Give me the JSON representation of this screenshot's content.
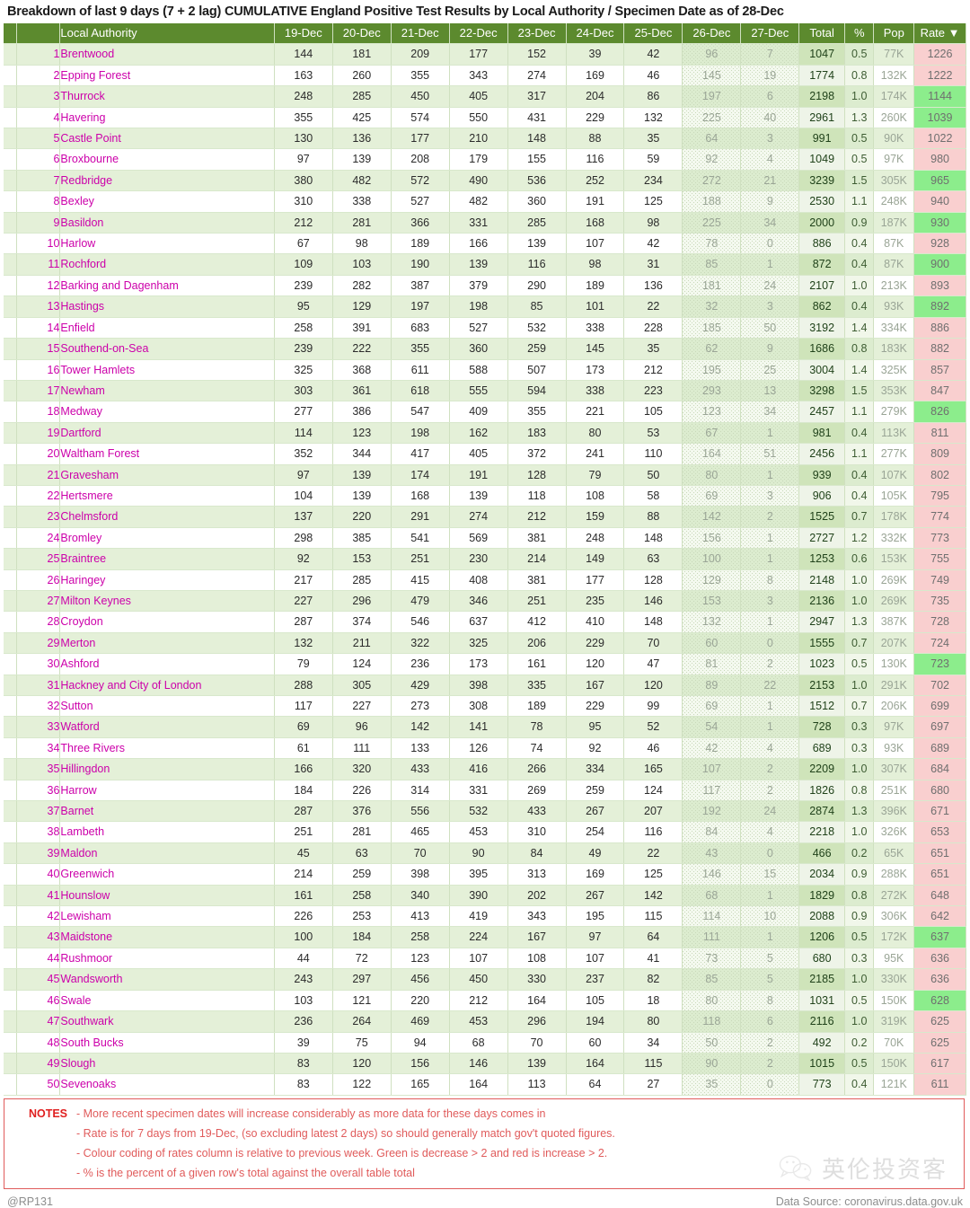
{
  "title": "Breakdown of last 9 days (7 + 2 lag)  CUMULATIVE England Positive Test Results by Local Authority / Specimen Date as of 28-Dec",
  "colors": {
    "header_green": "#5C8A2E",
    "row_stripe": "#e4f0d8",
    "rate_increase": "#f9cfcf",
    "rate_decrease": "#8ced8c",
    "authority_text": "#CC00AA",
    "notes_border": "#e05b5b"
  },
  "table": {
    "columns": [
      "Local Authority",
      "19-Dec",
      "20-Dec",
      "21-Dec",
      "22-Dec",
      "23-Dec",
      "24-Dec",
      "25-Dec",
      "26-Dec",
      "27-Dec",
      "Total",
      "%",
      "Pop",
      "Rate"
    ],
    "sort_column": "Rate",
    "sort_arrow": "▼",
    "lag_columns": [
      "26-Dec",
      "27-Dec"
    ],
    "rows": [
      {
        "n": "1",
        "la": "Brentwood",
        "d": [
          "144",
          "181",
          "209",
          "177",
          "152",
          "39",
          "42",
          "96",
          "7"
        ],
        "total": "1047",
        "pct": "0.5",
        "pop": "77K",
        "rate": "1226",
        "trend": "up"
      },
      {
        "n": "2",
        "la": "Epping Forest",
        "d": [
          "163",
          "260",
          "355",
          "343",
          "274",
          "169",
          "46",
          "145",
          "19"
        ],
        "total": "1774",
        "pct": "0.8",
        "pop": "132K",
        "rate": "1222",
        "trend": "up"
      },
      {
        "n": "3",
        "la": "Thurrock",
        "d": [
          "248",
          "285",
          "450",
          "405",
          "317",
          "204",
          "86",
          "197",
          "6"
        ],
        "total": "2198",
        "pct": "1.0",
        "pop": "174K",
        "rate": "1144",
        "trend": "down"
      },
      {
        "n": "4",
        "la": "Havering",
        "d": [
          "355",
          "425",
          "574",
          "550",
          "431",
          "229",
          "132",
          "225",
          "40"
        ],
        "total": "2961",
        "pct": "1.3",
        "pop": "260K",
        "rate": "1039",
        "trend": "down"
      },
      {
        "n": "5",
        "la": "Castle Point",
        "d": [
          "130",
          "136",
          "177",
          "210",
          "148",
          "88",
          "35",
          "64",
          "3"
        ],
        "total": "991",
        "pct": "0.5",
        "pop": "90K",
        "rate": "1022",
        "trend": "up"
      },
      {
        "n": "6",
        "la": "Broxbourne",
        "d": [
          "97",
          "139",
          "208",
          "179",
          "155",
          "116",
          "59",
          "92",
          "4"
        ],
        "total": "1049",
        "pct": "0.5",
        "pop": "97K",
        "rate": "980",
        "trend": "up"
      },
      {
        "n": "7",
        "la": "Redbridge",
        "d": [
          "380",
          "482",
          "572",
          "490",
          "536",
          "252",
          "234",
          "272",
          "21"
        ],
        "total": "3239",
        "pct": "1.5",
        "pop": "305K",
        "rate": "965",
        "trend": "down"
      },
      {
        "n": "8",
        "la": "Bexley",
        "d": [
          "310",
          "338",
          "527",
          "482",
          "360",
          "191",
          "125",
          "188",
          "9"
        ],
        "total": "2530",
        "pct": "1.1",
        "pop": "248K",
        "rate": "940",
        "trend": "up"
      },
      {
        "n": "9",
        "la": "Basildon",
        "d": [
          "212",
          "281",
          "366",
          "331",
          "285",
          "168",
          "98",
          "225",
          "34"
        ],
        "total": "2000",
        "pct": "0.9",
        "pop": "187K",
        "rate": "930",
        "trend": "down"
      },
      {
        "n": "10",
        "la": "Harlow",
        "d": [
          "67",
          "98",
          "189",
          "166",
          "139",
          "107",
          "42",
          "78",
          "0"
        ],
        "total": "886",
        "pct": "0.4",
        "pop": "87K",
        "rate": "928",
        "trend": "up"
      },
      {
        "n": "11",
        "la": "Rochford",
        "d": [
          "109",
          "103",
          "190",
          "139",
          "116",
          "98",
          "31",
          "85",
          "1"
        ],
        "total": "872",
        "pct": "0.4",
        "pop": "87K",
        "rate": "900",
        "trend": "down"
      },
      {
        "n": "12",
        "la": "Barking and Dagenham",
        "d": [
          "239",
          "282",
          "387",
          "379",
          "290",
          "189",
          "136",
          "181",
          "24"
        ],
        "total": "2107",
        "pct": "1.0",
        "pop": "213K",
        "rate": "893",
        "trend": "up"
      },
      {
        "n": "13",
        "la": "Hastings",
        "d": [
          "95",
          "129",
          "197",
          "198",
          "85",
          "101",
          "22",
          "32",
          "3"
        ],
        "total": "862",
        "pct": "0.4",
        "pop": "93K",
        "rate": "892",
        "trend": "down"
      },
      {
        "n": "14",
        "la": "Enfield",
        "d": [
          "258",
          "391",
          "683",
          "527",
          "532",
          "338",
          "228",
          "185",
          "50"
        ],
        "total": "3192",
        "pct": "1.4",
        "pop": "334K",
        "rate": "886",
        "trend": "up"
      },
      {
        "n": "15",
        "la": "Southend-on-Sea",
        "d": [
          "239",
          "222",
          "355",
          "360",
          "259",
          "145",
          "35",
          "62",
          "9"
        ],
        "total": "1686",
        "pct": "0.8",
        "pop": "183K",
        "rate": "882",
        "trend": "up"
      },
      {
        "n": "16",
        "la": "Tower Hamlets",
        "d": [
          "325",
          "368",
          "611",
          "588",
          "507",
          "173",
          "212",
          "195",
          "25"
        ],
        "total": "3004",
        "pct": "1.4",
        "pop": "325K",
        "rate": "857",
        "trend": "up"
      },
      {
        "n": "17",
        "la": "Newham",
        "d": [
          "303",
          "361",
          "618",
          "555",
          "594",
          "338",
          "223",
          "293",
          "13"
        ],
        "total": "3298",
        "pct": "1.5",
        "pop": "353K",
        "rate": "847",
        "trend": "up"
      },
      {
        "n": "18",
        "la": "Medway",
        "d": [
          "277",
          "386",
          "547",
          "409",
          "355",
          "221",
          "105",
          "123",
          "34"
        ],
        "total": "2457",
        "pct": "1.1",
        "pop": "279K",
        "rate": "826",
        "trend": "down"
      },
      {
        "n": "19",
        "la": "Dartford",
        "d": [
          "114",
          "123",
          "198",
          "162",
          "183",
          "80",
          "53",
          "67",
          "1"
        ],
        "total": "981",
        "pct": "0.4",
        "pop": "113K",
        "rate": "811",
        "trend": "up"
      },
      {
        "n": "20",
        "la": "Waltham Forest",
        "d": [
          "352",
          "344",
          "417",
          "405",
          "372",
          "241",
          "110",
          "164",
          "51"
        ],
        "total": "2456",
        "pct": "1.1",
        "pop": "277K",
        "rate": "809",
        "trend": "up"
      },
      {
        "n": "21",
        "la": "Gravesham",
        "d": [
          "97",
          "139",
          "174",
          "191",
          "128",
          "79",
          "50",
          "80",
          "1"
        ],
        "total": "939",
        "pct": "0.4",
        "pop": "107K",
        "rate": "802",
        "trend": "up"
      },
      {
        "n": "22",
        "la": "Hertsmere",
        "d": [
          "104",
          "139",
          "168",
          "139",
          "118",
          "108",
          "58",
          "69",
          "3"
        ],
        "total": "906",
        "pct": "0.4",
        "pop": "105K",
        "rate": "795",
        "trend": "up"
      },
      {
        "n": "23",
        "la": "Chelmsford",
        "d": [
          "137",
          "220",
          "291",
          "274",
          "212",
          "159",
          "88",
          "142",
          "2"
        ],
        "total": "1525",
        "pct": "0.7",
        "pop": "178K",
        "rate": "774",
        "trend": "up"
      },
      {
        "n": "24",
        "la": "Bromley",
        "d": [
          "298",
          "385",
          "541",
          "569",
          "381",
          "248",
          "148",
          "156",
          "1"
        ],
        "total": "2727",
        "pct": "1.2",
        "pop": "332K",
        "rate": "773",
        "trend": "up"
      },
      {
        "n": "25",
        "la": "Braintree",
        "d": [
          "92",
          "153",
          "251",
          "230",
          "214",
          "149",
          "63",
          "100",
          "1"
        ],
        "total": "1253",
        "pct": "0.6",
        "pop": "153K",
        "rate": "755",
        "trend": "up"
      },
      {
        "n": "26",
        "la": "Haringey",
        "d": [
          "217",
          "285",
          "415",
          "408",
          "381",
          "177",
          "128",
          "129",
          "8"
        ],
        "total": "2148",
        "pct": "1.0",
        "pop": "269K",
        "rate": "749",
        "trend": "up"
      },
      {
        "n": "27",
        "la": "Milton Keynes",
        "d": [
          "227",
          "296",
          "479",
          "346",
          "251",
          "235",
          "146",
          "153",
          "3"
        ],
        "total": "2136",
        "pct": "1.0",
        "pop": "269K",
        "rate": "735",
        "trend": "up"
      },
      {
        "n": "28",
        "la": "Croydon",
        "d": [
          "287",
          "374",
          "546",
          "637",
          "412",
          "410",
          "148",
          "132",
          "1"
        ],
        "total": "2947",
        "pct": "1.3",
        "pop": "387K",
        "rate": "728",
        "trend": "up"
      },
      {
        "n": "29",
        "la": "Merton",
        "d": [
          "132",
          "211",
          "322",
          "325",
          "206",
          "229",
          "70",
          "60",
          "0"
        ],
        "total": "1555",
        "pct": "0.7",
        "pop": "207K",
        "rate": "724",
        "trend": "up"
      },
      {
        "n": "30",
        "la": "Ashford",
        "d": [
          "79",
          "124",
          "236",
          "173",
          "161",
          "120",
          "47",
          "81",
          "2"
        ],
        "total": "1023",
        "pct": "0.5",
        "pop": "130K",
        "rate": "723",
        "trend": "down"
      },
      {
        "n": "31",
        "la": "Hackney and City of London",
        "d": [
          "288",
          "305",
          "429",
          "398",
          "335",
          "167",
          "120",
          "89",
          "22"
        ],
        "total": "2153",
        "pct": "1.0",
        "pop": "291K",
        "rate": "702",
        "trend": "up"
      },
      {
        "n": "32",
        "la": "Sutton",
        "d": [
          "117",
          "227",
          "273",
          "308",
          "189",
          "229",
          "99",
          "69",
          "1"
        ],
        "total": "1512",
        "pct": "0.7",
        "pop": "206K",
        "rate": "699",
        "trend": "up"
      },
      {
        "n": "33",
        "la": "Watford",
        "d": [
          "69",
          "96",
          "142",
          "141",
          "78",
          "95",
          "52",
          "54",
          "1"
        ],
        "total": "728",
        "pct": "0.3",
        "pop": "97K",
        "rate": "697",
        "trend": "up"
      },
      {
        "n": "34",
        "la": "Three Rivers",
        "d": [
          "61",
          "111",
          "133",
          "126",
          "74",
          "92",
          "46",
          "42",
          "4"
        ],
        "total": "689",
        "pct": "0.3",
        "pop": "93K",
        "rate": "689",
        "trend": "up"
      },
      {
        "n": "35",
        "la": "Hillingdon",
        "d": [
          "166",
          "320",
          "433",
          "416",
          "266",
          "334",
          "165",
          "107",
          "2"
        ],
        "total": "2209",
        "pct": "1.0",
        "pop": "307K",
        "rate": "684",
        "trend": "up"
      },
      {
        "n": "36",
        "la": "Harrow",
        "d": [
          "184",
          "226",
          "314",
          "331",
          "269",
          "259",
          "124",
          "117",
          "2"
        ],
        "total": "1826",
        "pct": "0.8",
        "pop": "251K",
        "rate": "680",
        "trend": "up"
      },
      {
        "n": "37",
        "la": "Barnet",
        "d": [
          "287",
          "376",
          "556",
          "532",
          "433",
          "267",
          "207",
          "192",
          "24"
        ],
        "total": "2874",
        "pct": "1.3",
        "pop": "396K",
        "rate": "671",
        "trend": "up"
      },
      {
        "n": "38",
        "la": "Lambeth",
        "d": [
          "251",
          "281",
          "465",
          "453",
          "310",
          "254",
          "116",
          "84",
          "4"
        ],
        "total": "2218",
        "pct": "1.0",
        "pop": "326K",
        "rate": "653",
        "trend": "up"
      },
      {
        "n": "39",
        "la": "Maldon",
        "d": [
          "45",
          "63",
          "70",
          "90",
          "84",
          "49",
          "22",
          "43",
          "0"
        ],
        "total": "466",
        "pct": "0.2",
        "pop": "65K",
        "rate": "651",
        "trend": "up"
      },
      {
        "n": "40",
        "la": "Greenwich",
        "d": [
          "214",
          "259",
          "398",
          "395",
          "313",
          "169",
          "125",
          "146",
          "15"
        ],
        "total": "2034",
        "pct": "0.9",
        "pop": "288K",
        "rate": "651",
        "trend": "up"
      },
      {
        "n": "41",
        "la": "Hounslow",
        "d": [
          "161",
          "258",
          "340",
          "390",
          "202",
          "267",
          "142",
          "68",
          "1"
        ],
        "total": "1829",
        "pct": "0.8",
        "pop": "272K",
        "rate": "648",
        "trend": "up"
      },
      {
        "n": "42",
        "la": "Lewisham",
        "d": [
          "226",
          "253",
          "413",
          "419",
          "343",
          "195",
          "115",
          "114",
          "10"
        ],
        "total": "2088",
        "pct": "0.9",
        "pop": "306K",
        "rate": "642",
        "trend": "up"
      },
      {
        "n": "43",
        "la": "Maidstone",
        "d": [
          "100",
          "184",
          "258",
          "224",
          "167",
          "97",
          "64",
          "111",
          "1"
        ],
        "total": "1206",
        "pct": "0.5",
        "pop": "172K",
        "rate": "637",
        "trend": "down"
      },
      {
        "n": "44",
        "la": "Rushmoor",
        "d": [
          "44",
          "72",
          "123",
          "107",
          "108",
          "107",
          "41",
          "73",
          "5"
        ],
        "total": "680",
        "pct": "0.3",
        "pop": "95K",
        "rate": "636",
        "trend": "up"
      },
      {
        "n": "45",
        "la": "Wandsworth",
        "d": [
          "243",
          "297",
          "456",
          "450",
          "330",
          "237",
          "82",
          "85",
          "5"
        ],
        "total": "2185",
        "pct": "1.0",
        "pop": "330K",
        "rate": "636",
        "trend": "up"
      },
      {
        "n": "46",
        "la": "Swale",
        "d": [
          "103",
          "121",
          "220",
          "212",
          "164",
          "105",
          "18",
          "80",
          "8"
        ],
        "total": "1031",
        "pct": "0.5",
        "pop": "150K",
        "rate": "628",
        "trend": "down"
      },
      {
        "n": "47",
        "la": "Southwark",
        "d": [
          "236",
          "264",
          "469",
          "453",
          "296",
          "194",
          "80",
          "118",
          "6"
        ],
        "total": "2116",
        "pct": "1.0",
        "pop": "319K",
        "rate": "625",
        "trend": "up"
      },
      {
        "n": "48",
        "la": "South Bucks",
        "d": [
          "39",
          "75",
          "94",
          "68",
          "70",
          "60",
          "34",
          "50",
          "2"
        ],
        "total": "492",
        "pct": "0.2",
        "pop": "70K",
        "rate": "625",
        "trend": "up"
      },
      {
        "n": "49",
        "la": "Slough",
        "d": [
          "83",
          "120",
          "156",
          "146",
          "139",
          "164",
          "115",
          "90",
          "2"
        ],
        "total": "1015",
        "pct": "0.5",
        "pop": "150K",
        "rate": "617",
        "trend": "up"
      },
      {
        "n": "50",
        "la": "Sevenoaks",
        "d": [
          "83",
          "122",
          "165",
          "164",
          "113",
          "64",
          "27",
          "35",
          "0"
        ],
        "total": "773",
        "pct": "0.4",
        "pop": "121K",
        "rate": "611",
        "trend": "up"
      }
    ]
  },
  "notes": {
    "label": "NOTES",
    "lines": [
      "- More recent specimen dates will increase considerably as more data for these days comes in",
      "- Rate is for 7 days from 19-Dec, (so excluding latest 2 days) so should generally match gov't quoted figures.",
      "- Colour coding of rates column is relative to previous week. Green is decrease > 2 and red is increase > 2.",
      "- % is the percent of a given row's total against the overall table total"
    ],
    "watermark_text": "英伦投资客"
  },
  "footer": {
    "author": "@RP131",
    "source": "Data Source: coronavirus.data.gov.uk"
  }
}
